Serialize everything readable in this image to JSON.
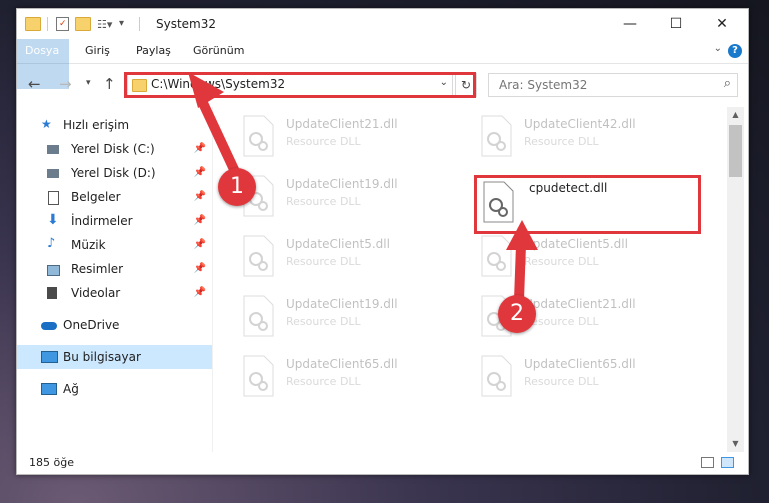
{
  "window": {
    "title": "System32",
    "controls": {
      "minimize": "—",
      "maximize": "☐",
      "close": "✕"
    }
  },
  "ribbon": {
    "tabs": [
      "Dosya",
      "Giriş",
      "Paylaş",
      "Görünüm"
    ],
    "help": "?"
  },
  "nav": {
    "back": "←",
    "forward": "→",
    "recent": "▾",
    "up": "↑",
    "address": "C:\\Windows\\System32",
    "refresh": "↻",
    "search_placeholder": "Ara: System32"
  },
  "sidebar": {
    "items": [
      {
        "label": "Hızlı erişim",
        "icon": "star-icon"
      },
      {
        "label": "Yerel Disk (C:)",
        "icon": "drive-icon",
        "pinned": true
      },
      {
        "label": "Yerel Disk (D:)",
        "icon": "drive-icon",
        "pinned": true
      },
      {
        "label": "Belgeler",
        "icon": "document-icon",
        "pinned": true
      },
      {
        "label": "İndirmeler",
        "icon": "download-icon",
        "pinned": true
      },
      {
        "label": "Müzik",
        "icon": "music-icon",
        "pinned": true
      },
      {
        "label": "Resimler",
        "icon": "pictures-icon",
        "pinned": true
      },
      {
        "label": "Videolar",
        "icon": "videos-icon",
        "pinned": true
      },
      {
        "label": "OneDrive",
        "icon": "cloud-icon"
      },
      {
        "label": "Bu bilgisayar",
        "icon": "computer-icon",
        "selected": true
      },
      {
        "label": "Ağ",
        "icon": "network-icon"
      }
    ]
  },
  "files": [
    {
      "name": "UpdateClient21.dll",
      "desc": "Resource DLL"
    },
    {
      "name": "UpdateClient42.dll",
      "desc": "Resource DLL"
    },
    {
      "name": "UpdateClient19.dll",
      "desc": "Resource DLL"
    },
    {
      "name": "cpudetect.dll",
      "desc": ""
    },
    {
      "name": "UpdateClient5.dll",
      "desc": "Resource DLL"
    },
    {
      "name": "UpdateClient5.dll",
      "desc": "Resource DLL"
    },
    {
      "name": "UpdateClient19.dll",
      "desc": "Resource DLL"
    },
    {
      "name": "UpdateClient21.dll",
      "desc": "Resource DLL"
    },
    {
      "name": "UpdateClient65.dll",
      "desc": "Resource DLL"
    },
    {
      "name": "UpdateClient65.dll",
      "desc": "Resource DLL"
    }
  ],
  "status": {
    "count": "185 öğe"
  },
  "annotations": {
    "step1": "1",
    "step2": "2",
    "color": "#e0373c"
  },
  "colors": {
    "accent": "#1979ca",
    "selected": "#cce8ff",
    "highlight": "#e0373c"
  }
}
